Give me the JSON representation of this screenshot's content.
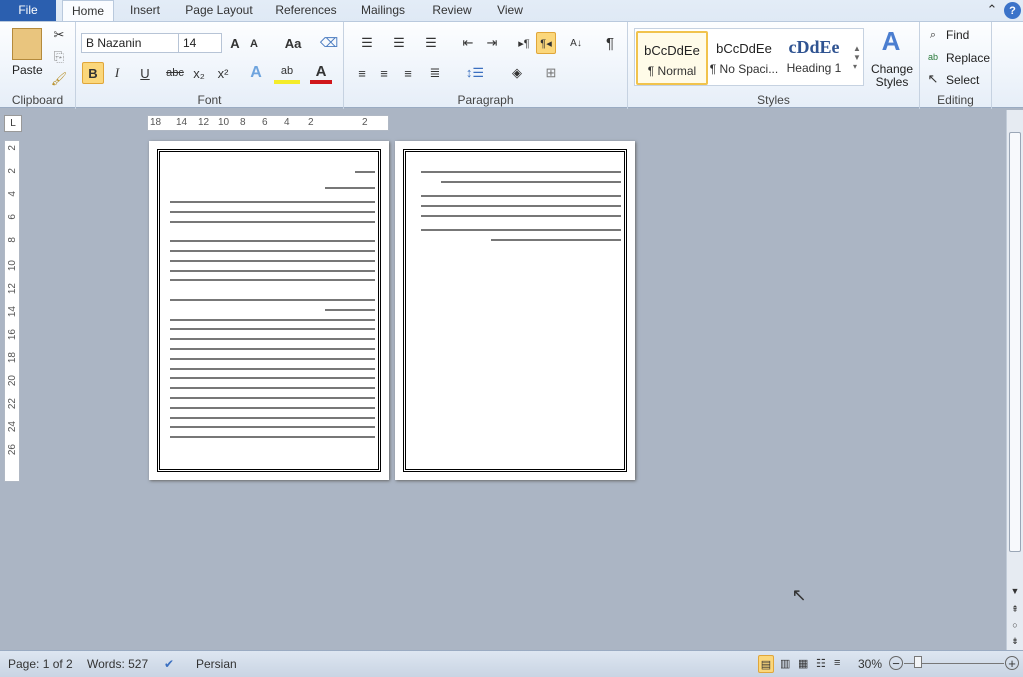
{
  "tabs": [
    "File",
    "Home",
    "Insert",
    "Page Layout",
    "References",
    "Mailings",
    "Review",
    "View"
  ],
  "clipboard": {
    "paste": "Paste",
    "label": "Clipboard"
  },
  "font": {
    "name": "B Nazanin",
    "size": "14",
    "label": "Font",
    "case": "Aa"
  },
  "paragraph": {
    "label": "Paragraph"
  },
  "styles": {
    "label": "Styles",
    "items": [
      {
        "preview": "bCcDdEe",
        "name": "¶ Normal"
      },
      {
        "preview": "bCcDdEe",
        "name": "¶ No Spaci..."
      },
      {
        "preview": "cDdEe",
        "name": "Heading 1"
      }
    ],
    "change": "Change Styles"
  },
  "editing": {
    "label": "Editing",
    "find": "Find",
    "replace": "Replace",
    "select": "Select"
  },
  "ruler": {
    "h": [
      "18",
      "14",
      "12",
      "10",
      "8",
      "6",
      "4",
      "2",
      "2"
    ],
    "v": [
      "2",
      "2",
      "4",
      "6",
      "8",
      "10",
      "12",
      "14",
      "16",
      "18",
      "20",
      "22",
      "24",
      "26"
    ]
  },
  "status": {
    "page": "Page: 1 of 2",
    "words": "Words: 527",
    "language": "Persian",
    "zoom": "30%"
  },
  "colors": {
    "accent": "#2b5faf",
    "highlight": "#fbd77b"
  }
}
